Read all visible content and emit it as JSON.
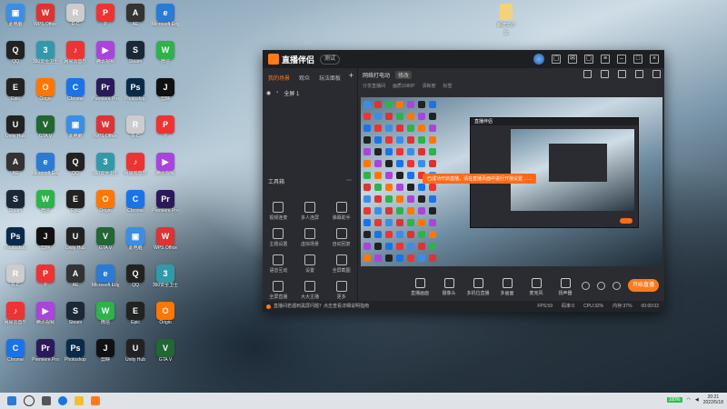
{
  "desktop_top_icon": {
    "label": "新建文件夹"
  },
  "desktop_icons": [
    {
      "label": "此电脑",
      "color": "#3a8ee8",
      "glyph": "▣"
    },
    {
      "label": "WPS Office",
      "color": "#d33",
      "glyph": "W"
    },
    {
      "label": "R-C",
      "color": "#ccc",
      "glyph": "R"
    },
    {
      "label": "P",
      "color": "#e33",
      "glyph": "P"
    },
    {
      "label": "AE",
      "color": "#333",
      "glyph": "A"
    },
    {
      "label": "Microsoft Edge",
      "color": "#2b7bd6",
      "glyph": "e"
    },
    {
      "label": "QQ",
      "color": "#222",
      "glyph": "Q"
    },
    {
      "label": "360安全卫士",
      "color": "#39a",
      "glyph": "3"
    },
    {
      "label": "网易云音乐",
      "color": "#e33",
      "glyph": "♪"
    },
    {
      "label": "腾讯视频",
      "color": "#a4d",
      "glyph": "▶"
    },
    {
      "label": "Steam",
      "color": "#1b2838",
      "glyph": "S"
    },
    {
      "label": "微信",
      "color": "#2db34a",
      "glyph": "W"
    },
    {
      "label": "Epic",
      "color": "#222",
      "glyph": "E"
    },
    {
      "label": "Origin",
      "color": "#f70",
      "glyph": "O"
    },
    {
      "label": "Chrome",
      "color": "#1a73e8",
      "glyph": "C"
    },
    {
      "label": "Premiere Pro",
      "color": "#2a1a5a",
      "glyph": "Pr"
    },
    {
      "label": "Photoshop",
      "color": "#0b2a4a",
      "glyph": "Ps"
    },
    {
      "label": "剪映",
      "color": "#111",
      "glyph": "J"
    },
    {
      "label": "Unity Hub",
      "color": "#222",
      "glyph": "U"
    },
    {
      "label": "GTA V",
      "color": "#263",
      "glyph": "V"
    }
  ],
  "window": {
    "title": "直播伴侣",
    "version": "测试",
    "tabs": [
      "我的场景",
      "观众",
      "玩法面板"
    ],
    "scene_name": "全屏 1",
    "tool_header": "工具箱",
    "tools": [
      "视频连麦",
      "多人连屏",
      "弹幕助手",
      "主题设置",
      "虚拟场景",
      "自动回复",
      "语音互动",
      "设置",
      "全屏截图",
      "全屏直播",
      "大大主播",
      "更多"
    ],
    "live_title": "网络打电动",
    "live_tag": "修改",
    "sub_info": [
      "分享直播间",
      "画质1080P",
      "清晰度",
      "标签"
    ],
    "toast": "已成功开启直播，请在直播页面中进行开播设置……",
    "controls": [
      "直播画面",
      "摄像头",
      "多机位直播",
      "多画面",
      "麦克风",
      "扬声器"
    ],
    "go_live_label": "开始直播",
    "status_msg": "直播间若遇到黑屏问题？点击查看详细说明指南",
    "status_stats": [
      "FPS:59",
      "码率:0",
      "CPU:32%",
      "内存:37%",
      "00:00:02"
    ]
  },
  "taskbar": {
    "battery": "100%",
    "time": "20:21",
    "date": "2022/5/18"
  }
}
